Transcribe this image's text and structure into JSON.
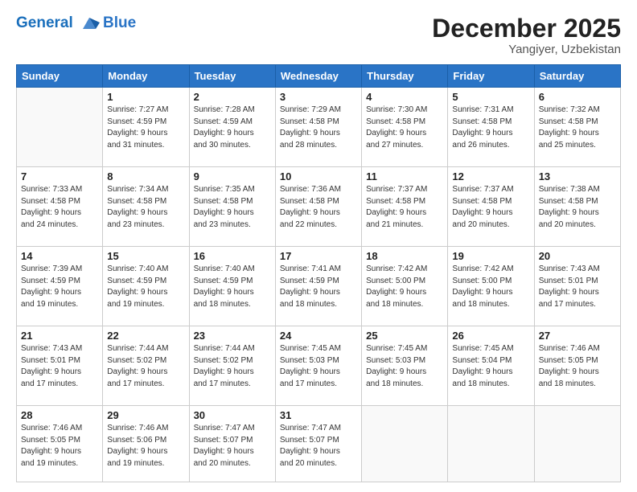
{
  "header": {
    "logo_line1": "General",
    "logo_line2": "Blue",
    "month_title": "December 2025",
    "subtitle": "Yangiyer, Uzbekistan"
  },
  "weekdays": [
    "Sunday",
    "Monday",
    "Tuesday",
    "Wednesday",
    "Thursday",
    "Friday",
    "Saturday"
  ],
  "weeks": [
    [
      {
        "day": "",
        "info": ""
      },
      {
        "day": "1",
        "info": "Sunrise: 7:27 AM\nSunset: 4:59 PM\nDaylight: 9 hours\nand 31 minutes."
      },
      {
        "day": "2",
        "info": "Sunrise: 7:28 AM\nSunset: 4:59 AM\nDaylight: 9 hours\nand 30 minutes."
      },
      {
        "day": "3",
        "info": "Sunrise: 7:29 AM\nSunset: 4:58 PM\nDaylight: 9 hours\nand 28 minutes."
      },
      {
        "day": "4",
        "info": "Sunrise: 7:30 AM\nSunset: 4:58 PM\nDaylight: 9 hours\nand 27 minutes."
      },
      {
        "day": "5",
        "info": "Sunrise: 7:31 AM\nSunset: 4:58 PM\nDaylight: 9 hours\nand 26 minutes."
      },
      {
        "day": "6",
        "info": "Sunrise: 7:32 AM\nSunset: 4:58 PM\nDaylight: 9 hours\nand 25 minutes."
      }
    ],
    [
      {
        "day": "7",
        "info": "Sunrise: 7:33 AM\nSunset: 4:58 PM\nDaylight: 9 hours\nand 24 minutes."
      },
      {
        "day": "8",
        "info": "Sunrise: 7:34 AM\nSunset: 4:58 PM\nDaylight: 9 hours\nand 23 minutes."
      },
      {
        "day": "9",
        "info": "Sunrise: 7:35 AM\nSunset: 4:58 PM\nDaylight: 9 hours\nand 23 minutes."
      },
      {
        "day": "10",
        "info": "Sunrise: 7:36 AM\nSunset: 4:58 PM\nDaylight: 9 hours\nand 22 minutes."
      },
      {
        "day": "11",
        "info": "Sunrise: 7:37 AM\nSunset: 4:58 PM\nDaylight: 9 hours\nand 21 minutes."
      },
      {
        "day": "12",
        "info": "Sunrise: 7:37 AM\nSunset: 4:58 PM\nDaylight: 9 hours\nand 20 minutes."
      },
      {
        "day": "13",
        "info": "Sunrise: 7:38 AM\nSunset: 4:58 PM\nDaylight: 9 hours\nand 20 minutes."
      }
    ],
    [
      {
        "day": "14",
        "info": "Sunrise: 7:39 AM\nSunset: 4:59 PM\nDaylight: 9 hours\nand 19 minutes."
      },
      {
        "day": "15",
        "info": "Sunrise: 7:40 AM\nSunset: 4:59 PM\nDaylight: 9 hours\nand 19 minutes."
      },
      {
        "day": "16",
        "info": "Sunrise: 7:40 AM\nSunset: 4:59 PM\nDaylight: 9 hours\nand 18 minutes."
      },
      {
        "day": "17",
        "info": "Sunrise: 7:41 AM\nSunset: 4:59 PM\nDaylight: 9 hours\nand 18 minutes."
      },
      {
        "day": "18",
        "info": "Sunrise: 7:42 AM\nSunset: 5:00 PM\nDaylight: 9 hours\nand 18 minutes."
      },
      {
        "day": "19",
        "info": "Sunrise: 7:42 AM\nSunset: 5:00 PM\nDaylight: 9 hours\nand 18 minutes."
      },
      {
        "day": "20",
        "info": "Sunrise: 7:43 AM\nSunset: 5:01 PM\nDaylight: 9 hours\nand 17 minutes."
      }
    ],
    [
      {
        "day": "21",
        "info": "Sunrise: 7:43 AM\nSunset: 5:01 PM\nDaylight: 9 hours\nand 17 minutes."
      },
      {
        "day": "22",
        "info": "Sunrise: 7:44 AM\nSunset: 5:02 PM\nDaylight: 9 hours\nand 17 minutes."
      },
      {
        "day": "23",
        "info": "Sunrise: 7:44 AM\nSunset: 5:02 PM\nDaylight: 9 hours\nand 17 minutes."
      },
      {
        "day": "24",
        "info": "Sunrise: 7:45 AM\nSunset: 5:03 PM\nDaylight: 9 hours\nand 17 minutes."
      },
      {
        "day": "25",
        "info": "Sunrise: 7:45 AM\nSunset: 5:03 PM\nDaylight: 9 hours\nand 18 minutes."
      },
      {
        "day": "26",
        "info": "Sunrise: 7:45 AM\nSunset: 5:04 PM\nDaylight: 9 hours\nand 18 minutes."
      },
      {
        "day": "27",
        "info": "Sunrise: 7:46 AM\nSunset: 5:05 PM\nDaylight: 9 hours\nand 18 minutes."
      }
    ],
    [
      {
        "day": "28",
        "info": "Sunrise: 7:46 AM\nSunset: 5:05 PM\nDaylight: 9 hours\nand 19 minutes."
      },
      {
        "day": "29",
        "info": "Sunrise: 7:46 AM\nSunset: 5:06 PM\nDaylight: 9 hours\nand 19 minutes."
      },
      {
        "day": "30",
        "info": "Sunrise: 7:47 AM\nSunset: 5:07 PM\nDaylight: 9 hours\nand 20 minutes."
      },
      {
        "day": "31",
        "info": "Sunrise: 7:47 AM\nSunset: 5:07 PM\nDaylight: 9 hours\nand 20 minutes."
      },
      {
        "day": "",
        "info": ""
      },
      {
        "day": "",
        "info": ""
      },
      {
        "day": "",
        "info": ""
      }
    ]
  ]
}
